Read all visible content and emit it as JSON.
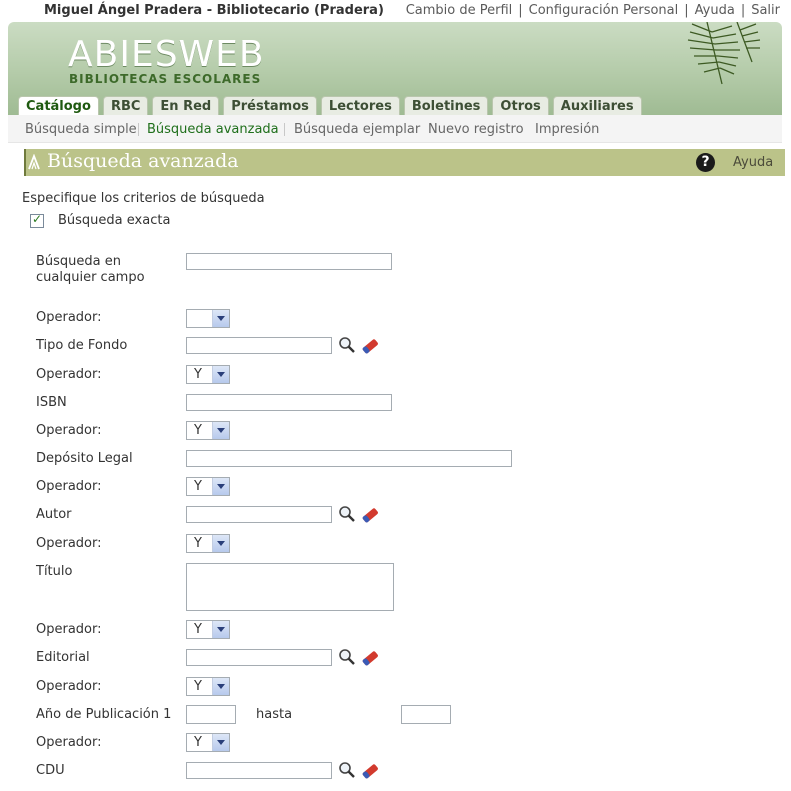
{
  "topbar": {
    "user": "Miguel Ángel Pradera - Bibliotecario (Pradera)",
    "links": [
      "Cambio de Perfil",
      "Configuración Personal",
      "Ayuda",
      "Salir"
    ]
  },
  "logo": {
    "title": "ABIESWEB",
    "subtitle": "BIBLIOTECAS ESCOLARES"
  },
  "tabs": [
    "Catálogo",
    "RBC",
    "En Red",
    "Préstamos",
    "Lectores",
    "Boletines",
    "Otros",
    "Auxiliares"
  ],
  "subnav": [
    "Búsqueda simple",
    "Búsqueda avanzada",
    "Búsqueda ejemplar",
    "Nuevo registro",
    "Impresión"
  ],
  "section": {
    "title": "Búsqueda avanzada",
    "help": "Ayuda"
  },
  "form": {
    "intro": "Especifique los criterios de búsqueda",
    "exact_label": "Búsqueda exacta",
    "any_field_label": "Búsqueda en cualquier campo",
    "operator_label": "Operador:",
    "operator_value": "Y",
    "tipo_fondo": "Tipo de Fondo",
    "isbn": "ISBN",
    "deposito": "Depósito Legal",
    "autor": "Autor",
    "titulo": "Título",
    "editorial": "Editorial",
    "anio": "Año de Publicación 1",
    "hasta": "hasta",
    "cdu": "CDU"
  },
  "colors": {
    "header_green": "#b4cba9",
    "section_bar": "#bbc389",
    "active_link": "#1f6f1b"
  }
}
